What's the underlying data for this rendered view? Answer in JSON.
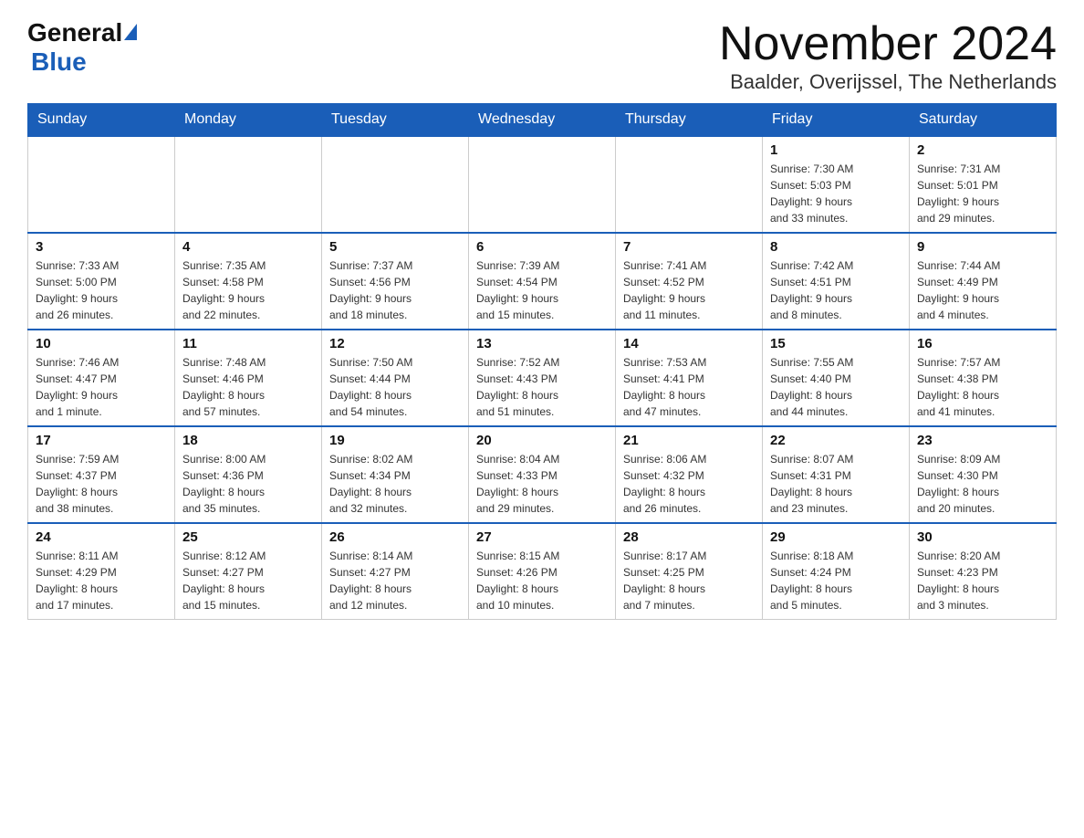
{
  "header": {
    "logo_general": "General",
    "logo_blue": "Blue",
    "title": "November 2024",
    "subtitle": "Baalder, Overijssel, The Netherlands"
  },
  "calendar": {
    "days_of_week": [
      "Sunday",
      "Monday",
      "Tuesday",
      "Wednesday",
      "Thursday",
      "Friday",
      "Saturday"
    ],
    "weeks": [
      [
        {
          "day": "",
          "info": ""
        },
        {
          "day": "",
          "info": ""
        },
        {
          "day": "",
          "info": ""
        },
        {
          "day": "",
          "info": ""
        },
        {
          "day": "",
          "info": ""
        },
        {
          "day": "1",
          "info": "Sunrise: 7:30 AM\nSunset: 5:03 PM\nDaylight: 9 hours\nand 33 minutes."
        },
        {
          "day": "2",
          "info": "Sunrise: 7:31 AM\nSunset: 5:01 PM\nDaylight: 9 hours\nand 29 minutes."
        }
      ],
      [
        {
          "day": "3",
          "info": "Sunrise: 7:33 AM\nSunset: 5:00 PM\nDaylight: 9 hours\nand 26 minutes."
        },
        {
          "day": "4",
          "info": "Sunrise: 7:35 AM\nSunset: 4:58 PM\nDaylight: 9 hours\nand 22 minutes."
        },
        {
          "day": "5",
          "info": "Sunrise: 7:37 AM\nSunset: 4:56 PM\nDaylight: 9 hours\nand 18 minutes."
        },
        {
          "day": "6",
          "info": "Sunrise: 7:39 AM\nSunset: 4:54 PM\nDaylight: 9 hours\nand 15 minutes."
        },
        {
          "day": "7",
          "info": "Sunrise: 7:41 AM\nSunset: 4:52 PM\nDaylight: 9 hours\nand 11 minutes."
        },
        {
          "day": "8",
          "info": "Sunrise: 7:42 AM\nSunset: 4:51 PM\nDaylight: 9 hours\nand 8 minutes."
        },
        {
          "day": "9",
          "info": "Sunrise: 7:44 AM\nSunset: 4:49 PM\nDaylight: 9 hours\nand 4 minutes."
        }
      ],
      [
        {
          "day": "10",
          "info": "Sunrise: 7:46 AM\nSunset: 4:47 PM\nDaylight: 9 hours\nand 1 minute."
        },
        {
          "day": "11",
          "info": "Sunrise: 7:48 AM\nSunset: 4:46 PM\nDaylight: 8 hours\nand 57 minutes."
        },
        {
          "day": "12",
          "info": "Sunrise: 7:50 AM\nSunset: 4:44 PM\nDaylight: 8 hours\nand 54 minutes."
        },
        {
          "day": "13",
          "info": "Sunrise: 7:52 AM\nSunset: 4:43 PM\nDaylight: 8 hours\nand 51 minutes."
        },
        {
          "day": "14",
          "info": "Sunrise: 7:53 AM\nSunset: 4:41 PM\nDaylight: 8 hours\nand 47 minutes."
        },
        {
          "day": "15",
          "info": "Sunrise: 7:55 AM\nSunset: 4:40 PM\nDaylight: 8 hours\nand 44 minutes."
        },
        {
          "day": "16",
          "info": "Sunrise: 7:57 AM\nSunset: 4:38 PM\nDaylight: 8 hours\nand 41 minutes."
        }
      ],
      [
        {
          "day": "17",
          "info": "Sunrise: 7:59 AM\nSunset: 4:37 PM\nDaylight: 8 hours\nand 38 minutes."
        },
        {
          "day": "18",
          "info": "Sunrise: 8:00 AM\nSunset: 4:36 PM\nDaylight: 8 hours\nand 35 minutes."
        },
        {
          "day": "19",
          "info": "Sunrise: 8:02 AM\nSunset: 4:34 PM\nDaylight: 8 hours\nand 32 minutes."
        },
        {
          "day": "20",
          "info": "Sunrise: 8:04 AM\nSunset: 4:33 PM\nDaylight: 8 hours\nand 29 minutes."
        },
        {
          "day": "21",
          "info": "Sunrise: 8:06 AM\nSunset: 4:32 PM\nDaylight: 8 hours\nand 26 minutes."
        },
        {
          "day": "22",
          "info": "Sunrise: 8:07 AM\nSunset: 4:31 PM\nDaylight: 8 hours\nand 23 minutes."
        },
        {
          "day": "23",
          "info": "Sunrise: 8:09 AM\nSunset: 4:30 PM\nDaylight: 8 hours\nand 20 minutes."
        }
      ],
      [
        {
          "day": "24",
          "info": "Sunrise: 8:11 AM\nSunset: 4:29 PM\nDaylight: 8 hours\nand 17 minutes."
        },
        {
          "day": "25",
          "info": "Sunrise: 8:12 AM\nSunset: 4:27 PM\nDaylight: 8 hours\nand 15 minutes."
        },
        {
          "day": "26",
          "info": "Sunrise: 8:14 AM\nSunset: 4:27 PM\nDaylight: 8 hours\nand 12 minutes."
        },
        {
          "day": "27",
          "info": "Sunrise: 8:15 AM\nSunset: 4:26 PM\nDaylight: 8 hours\nand 10 minutes."
        },
        {
          "day": "28",
          "info": "Sunrise: 8:17 AM\nSunset: 4:25 PM\nDaylight: 8 hours\nand 7 minutes."
        },
        {
          "day": "29",
          "info": "Sunrise: 8:18 AM\nSunset: 4:24 PM\nDaylight: 8 hours\nand 5 minutes."
        },
        {
          "day": "30",
          "info": "Sunrise: 8:20 AM\nSunset: 4:23 PM\nDaylight: 8 hours\nand 3 minutes."
        }
      ]
    ]
  }
}
